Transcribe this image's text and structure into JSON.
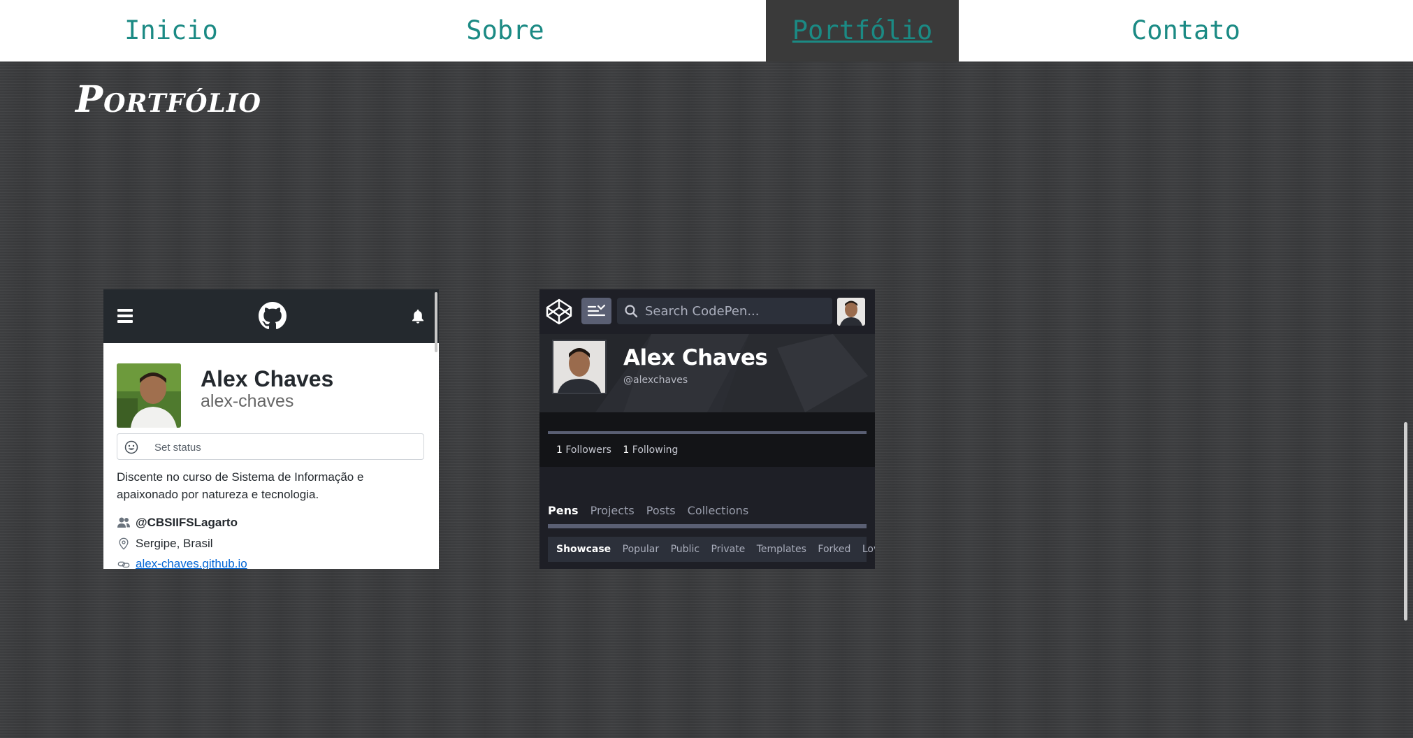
{
  "nav": {
    "items": [
      {
        "label": "Inicio"
      },
      {
        "label": "Sobre"
      },
      {
        "label": "Portfólio"
      },
      {
        "label": "Contato"
      }
    ],
    "active": "Portfólio"
  },
  "page": {
    "title": "Portfólio"
  },
  "github": {
    "name": "Alex Chaves",
    "login": "alex-chaves",
    "status_label": "Set status",
    "bio": "Discente no curso de Sistema de Informação e apaixonado por natureza e tecnologia.",
    "org": "@CBSIIFSLagarto",
    "location": "Sergipe, Brasil",
    "website": "alex-chaves.github.io",
    "icons": [
      "hamburger-menu-icon",
      "github-logo-icon",
      "bell-icon",
      "smiley-icon",
      "people-icon",
      "location-pin-icon",
      "link-icon"
    ]
  },
  "codepen": {
    "search_placeholder": "Search CodePen...",
    "name": "Alex Chaves",
    "handle": "@alexchaves",
    "followers_count": "1",
    "followers_label": "Followers",
    "following_count": "1",
    "following_label": "Following",
    "tabs": [
      {
        "label": "Pens"
      },
      {
        "label": "Projects"
      },
      {
        "label": "Posts"
      },
      {
        "label": "Collections"
      }
    ],
    "subtabs": [
      {
        "label": "Showcase"
      },
      {
        "label": "Popular"
      },
      {
        "label": "Public"
      },
      {
        "label": "Private"
      },
      {
        "label": "Templates"
      },
      {
        "label": "Forked"
      },
      {
        "label": "Loved"
      }
    ],
    "icons": [
      "codepen-logo-icon",
      "menu-toggle-icon",
      "search-icon"
    ]
  },
  "colors": {
    "nav_link": "#1b8a84",
    "nav_active_bg": "#3a3a3a",
    "page_bg": "#3a3b3d",
    "github_header": "#24292e",
    "github_link": "#0366d6",
    "codepen_bg": "#131417"
  }
}
